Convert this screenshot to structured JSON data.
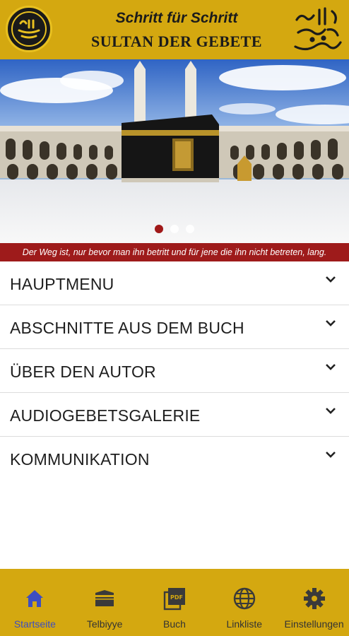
{
  "header": {
    "subtitle": "Schritt für Schritt",
    "title": "SULTAN DER GEBETE",
    "seal_text": "الله رسول محمد",
    "calligraphy_text": "صلى الله عليه وسلم"
  },
  "banner": {
    "slide_count": 3,
    "active_slide": 1
  },
  "quote": "Der Weg ist, nur bevor man ihn betritt und für jene die ihn nicht betreten, lang.",
  "menu": {
    "items": [
      {
        "label": "HAUPTMENU",
        "icon": "chevron-down-icon"
      },
      {
        "label": "ABSCHNITTE AUS DEM BUCH",
        "icon": "chevron-down-icon"
      },
      {
        "label": "ÜBER DEN AUTOR",
        "icon": "chevron-down-icon"
      },
      {
        "label": "AUDIOGEBETSGALERIE",
        "icon": "chevron-down-icon"
      },
      {
        "label": "KOMMUNIKATION",
        "icon": "chevron-down-icon"
      }
    ]
  },
  "bottom_nav": {
    "items": [
      {
        "label": "Startseite",
        "icon": "home-icon",
        "active": true
      },
      {
        "label": "Telbiyye",
        "icon": "kaaba-icon",
        "active": false
      },
      {
        "label": "Buch",
        "icon": "pdf-icon",
        "active": false
      },
      {
        "label": "Linkliste",
        "icon": "globe-icon",
        "active": false
      },
      {
        "label": "Einstellungen",
        "icon": "gear-icon",
        "active": false
      }
    ]
  },
  "colors": {
    "brand_gold": "#d4a810",
    "quote_red": "#9e1b1b",
    "active_blue": "#3d4ec0",
    "icon_dark": "#3a3a3a"
  }
}
